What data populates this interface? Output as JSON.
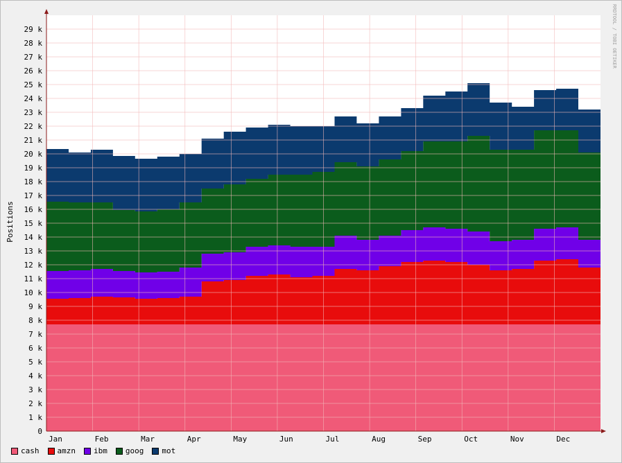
{
  "watermark": "RRDTOOL / TOBI OETIKER",
  "chart_data": {
    "type": "area",
    "stacked": true,
    "ylabel": "Positions",
    "xlabel": "",
    "ylim": [
      0,
      30000
    ],
    "yticks": [
      0,
      1000,
      2000,
      3000,
      4000,
      5000,
      6000,
      7000,
      8000,
      9000,
      10000,
      11000,
      12000,
      13000,
      14000,
      15000,
      16000,
      17000,
      18000,
      19000,
      20000,
      21000,
      22000,
      23000,
      24000,
      25000,
      26000,
      27000,
      28000,
      29000
    ],
    "ytick_labels": [
      "0",
      "1 k",
      "2 k",
      "3 k",
      "4 k",
      "5 k",
      "6 k",
      "7 k",
      "8 k",
      "9 k",
      "10 k",
      "11 k",
      "12 k",
      "13 k",
      "14 k",
      "15 k",
      "16 k",
      "17 k",
      "18 k",
      "19 k",
      "20 k",
      "21 k",
      "22 k",
      "23 k",
      "24 k",
      "25 k",
      "26 k",
      "27 k",
      "28 k",
      "29 k"
    ],
    "x_month_labels": [
      "Jan",
      "Feb",
      "Mar",
      "Apr",
      "May",
      "Jun",
      "Jul",
      "Aug",
      "Sep",
      "Oct",
      "Nov",
      "Dec"
    ],
    "grid": true,
    "legend_placement": "bottom-left",
    "colors": {
      "cash": "#f05a78",
      "amzn": "#e80c0c",
      "ibm": "#7000e8",
      "goog": "#0b5c1c",
      "mot": "#0b3a6e",
      "background": "#f0f0f0",
      "plot": "#ffffff",
      "grid": "#f2b8b8",
      "axis": "#8b1a1a"
    },
    "x_weeks": [
      "Jan wk1",
      "Jan wk3",
      "Feb wk1",
      "Feb wk3",
      "Mar wk1",
      "Mar wk3",
      "Apr wk1",
      "Apr wk3",
      "May wk1",
      "May wk3",
      "Jun wk1",
      "Jun wk3",
      "Jul wk1",
      "Jul wk3",
      "Aug wk1",
      "Aug wk3",
      "Sep wk1",
      "Sep wk3",
      "Oct wk1",
      "Oct wk3",
      "Nov wk1",
      "Nov wk3",
      "Dec wk1",
      "Dec wk3",
      "Dec end"
    ],
    "series": [
      {
        "name": "cash",
        "values": [
          7700,
          7700,
          7700,
          7700,
          7700,
          7700,
          7700,
          7700,
          7700,
          7700,
          7700,
          7700,
          7700,
          7700,
          7700,
          7700,
          7700,
          7700,
          7700,
          7700,
          7700,
          7700,
          7700,
          7700,
          7700
        ]
      },
      {
        "name": "amzn",
        "values": [
          1850,
          1900,
          2000,
          1950,
          1850,
          1900,
          2000,
          3100,
          3200,
          3500,
          3600,
          3400,
          3500,
          4000,
          3900,
          4200,
          4500,
          4600,
          4500,
          4300,
          3900,
          4000,
          4600,
          4700,
          4100
        ]
      },
      {
        "name": "ibm",
        "values": [
          2000,
          2000,
          2000,
          1900,
          1900,
          1900,
          2100,
          2000,
          2000,
          2100,
          2100,
          2200,
          2100,
          2400,
          2200,
          2200,
          2300,
          2400,
          2400,
          2400,
          2100,
          2100,
          2300,
          2300,
          2000
        ]
      },
      {
        "name": "goog",
        "values": [
          5000,
          4900,
          4800,
          4400,
          4400,
          4500,
          4700,
          4700,
          4900,
          4900,
          5100,
          5200,
          5400,
          5300,
          5300,
          5500,
          5700,
          6200,
          6300,
          6900,
          6600,
          6500,
          7100,
          7000,
          6300
        ]
      },
      {
        "name": "mot",
        "values": [
          3800,
          3600,
          3800,
          3900,
          3800,
          3800,
          3500,
          3600,
          3800,
          3700,
          3600,
          3500,
          3300,
          3300,
          3100,
          3100,
          3100,
          3300,
          3600,
          3800,
          3400,
          3100,
          2900,
          3000,
          3100
        ]
      }
    ]
  }
}
